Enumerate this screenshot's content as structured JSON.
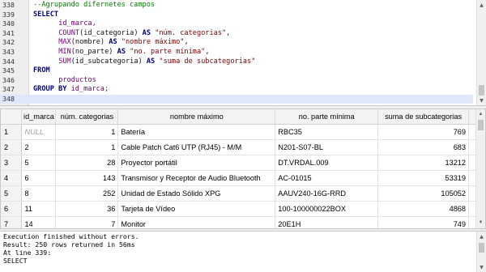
{
  "editor": {
    "lines": [
      {
        "n": "338",
        "text": "--Agrupando difernetes campos",
        "type": "comment"
      },
      {
        "n": "339",
        "text": "SELECT",
        "type": "keyword"
      },
      {
        "n": "340",
        "text": "id_marca,",
        "type": "ident"
      },
      {
        "n": "341",
        "fn": "COUNT",
        "inner": "(id_categoria) ",
        "as": "AS ",
        "alias": "\"núm. categorias\"",
        "tail": ","
      },
      {
        "n": "342",
        "fn": "MAX",
        "inner": "(nombre) ",
        "as": "AS ",
        "alias": "\"nombre máximo\"",
        "tail": ","
      },
      {
        "n": "343",
        "fn": "MIN",
        "inner": "(no_parte) ",
        "as": "AS ",
        "alias": "\"no. parte mínima\"",
        "tail": ","
      },
      {
        "n": "344",
        "fn": "SUM",
        "inner": "(id_subcategoria) ",
        "as": "AS ",
        "alias": "\"suma de subcategorias\"",
        "tail": ""
      },
      {
        "n": "345",
        "text": "FROM",
        "type": "keyword"
      },
      {
        "n": "346",
        "text": "productos",
        "type": "ident"
      },
      {
        "n": "347",
        "kw": "GROUP BY ",
        "rest": "id_marca;"
      },
      {
        "n": "348",
        "text": "",
        "type": "plain"
      }
    ]
  },
  "grid": {
    "columns": [
      "id_marca",
      "núm. categorias",
      "nombre máximo",
      "no. parte mínima",
      "suma de subcategorias"
    ],
    "rows": [
      {
        "row": "1",
        "id_marca": "NULL",
        "num_categorias": "1",
        "nombre": "Batería",
        "no_parte": "RBC35",
        "suma": "769"
      },
      {
        "row": "2",
        "id_marca": "2",
        "num_categorias": "1",
        "nombre": "Cable Patch Cat6 UTP (RJ45) - M/M",
        "no_parte": "N201-S07-BL",
        "suma": "683"
      },
      {
        "row": "3",
        "id_marca": "5",
        "num_categorias": "28",
        "nombre": "Proyector portátil",
        "no_parte": "DT.VRDAL.009",
        "suma": "13212"
      },
      {
        "row": "4",
        "id_marca": "6",
        "num_categorias": "143",
        "nombre": "Transmisor y Receptor de Audio Bluetooth",
        "no_parte": "AC-01015",
        "suma": "53319"
      },
      {
        "row": "5",
        "id_marca": "8",
        "num_categorias": "252",
        "nombre": "Unidad de Estado Sólido XPG",
        "no_parte": "AAUV240-16G-RRD",
        "suma": "105052"
      },
      {
        "row": "6",
        "id_marca": "11",
        "num_categorias": "36",
        "nombre": "Tarjeta de Vídeo",
        "no_parte": "100-100000022BOX",
        "suma": "4868"
      },
      {
        "row": "7",
        "id_marca": "14",
        "num_categorias": "7",
        "nombre": "Monitor",
        "no_parte": "20E1H",
        "suma": "749"
      }
    ]
  },
  "messages": {
    "lines": [
      "Execution finished without errors.",
      "Result: 250 rows returned in 56ms",
      "At line 339:",
      "SELECT"
    ]
  }
}
